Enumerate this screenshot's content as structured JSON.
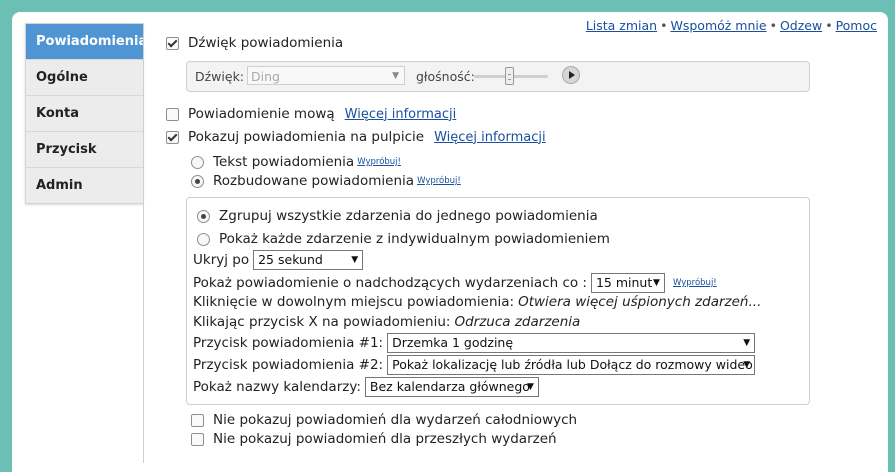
{
  "top_links": {
    "changelog": "Lista zmian",
    "support": "Wspomóż mnie",
    "feedback": "Odzew",
    "help": "Pomoc",
    "separator": "•"
  },
  "sidebar": {
    "items": [
      {
        "label": "Powiadomienia",
        "active": true
      },
      {
        "label": "Ogólne"
      },
      {
        "label": "Konta"
      },
      {
        "label": "Przycisk"
      },
      {
        "label": "Admin"
      }
    ]
  },
  "sound": {
    "checkbox_label": "Dźwięk powiadomienia",
    "checked": true,
    "sound_label": "Dźwięk:",
    "sound_value": "Ding",
    "volume_label": "głośność:",
    "volume_level": 0.5
  },
  "voice": {
    "checkbox_label": "Powiadomienie mową",
    "checked": false,
    "more_link": "Więcej informacji"
  },
  "desktop": {
    "checkbox_label": "Pokazuj powiadomienia na pulpicie",
    "checked": true,
    "more_link": "Więcej informacji",
    "radio_text": "Tekst powiadomienia",
    "radio_rich": "Rozbudowane powiadomienia",
    "try_link": "Wypróbuj!"
  },
  "details": {
    "group_all": "Zgrupuj wszystkie zdarzenia do jednego powiadomienia",
    "each_separate": "Pokaż każde zdarzenie z indywidualnym powiadomieniem",
    "hide_after_label": "Ukryj po",
    "hide_after_value": "25 sekund",
    "upcoming_label": "Pokaż powiadomienie o nadchodzących wydarzeniach co :",
    "upcoming_value": "15 minut",
    "try_link": "Wypróbuj!",
    "click_anywhere_label": "Kliknięcie w dowolnym miejscu powiadomienia:",
    "click_anywhere_value": "Otwiera więcej uśpionych zdarzeń...",
    "click_x_label": "Klikając przycisk X na powiadomieniu:",
    "click_x_value": "Odrzuca zdarzenia",
    "button1_label": "Przycisk powiadomienia #1:",
    "button1_value": "Drzemka 1 godzinę",
    "button2_label": "Przycisk powiadomienia #2:",
    "button2_value": "Pokaż lokalizację lub źródła lub Dołącz do rozmowy wideo",
    "calendars_label": "Pokaż nazwy kalendarzy:",
    "calendars_value": "Bez kalendarza głównego"
  },
  "bottom": {
    "no_all_day": "Nie pokazuj powiadomień dla wydarzeń całodniowych",
    "no_past": "Nie pokazuj powiadomień dla przeszłych wydarzeń"
  }
}
